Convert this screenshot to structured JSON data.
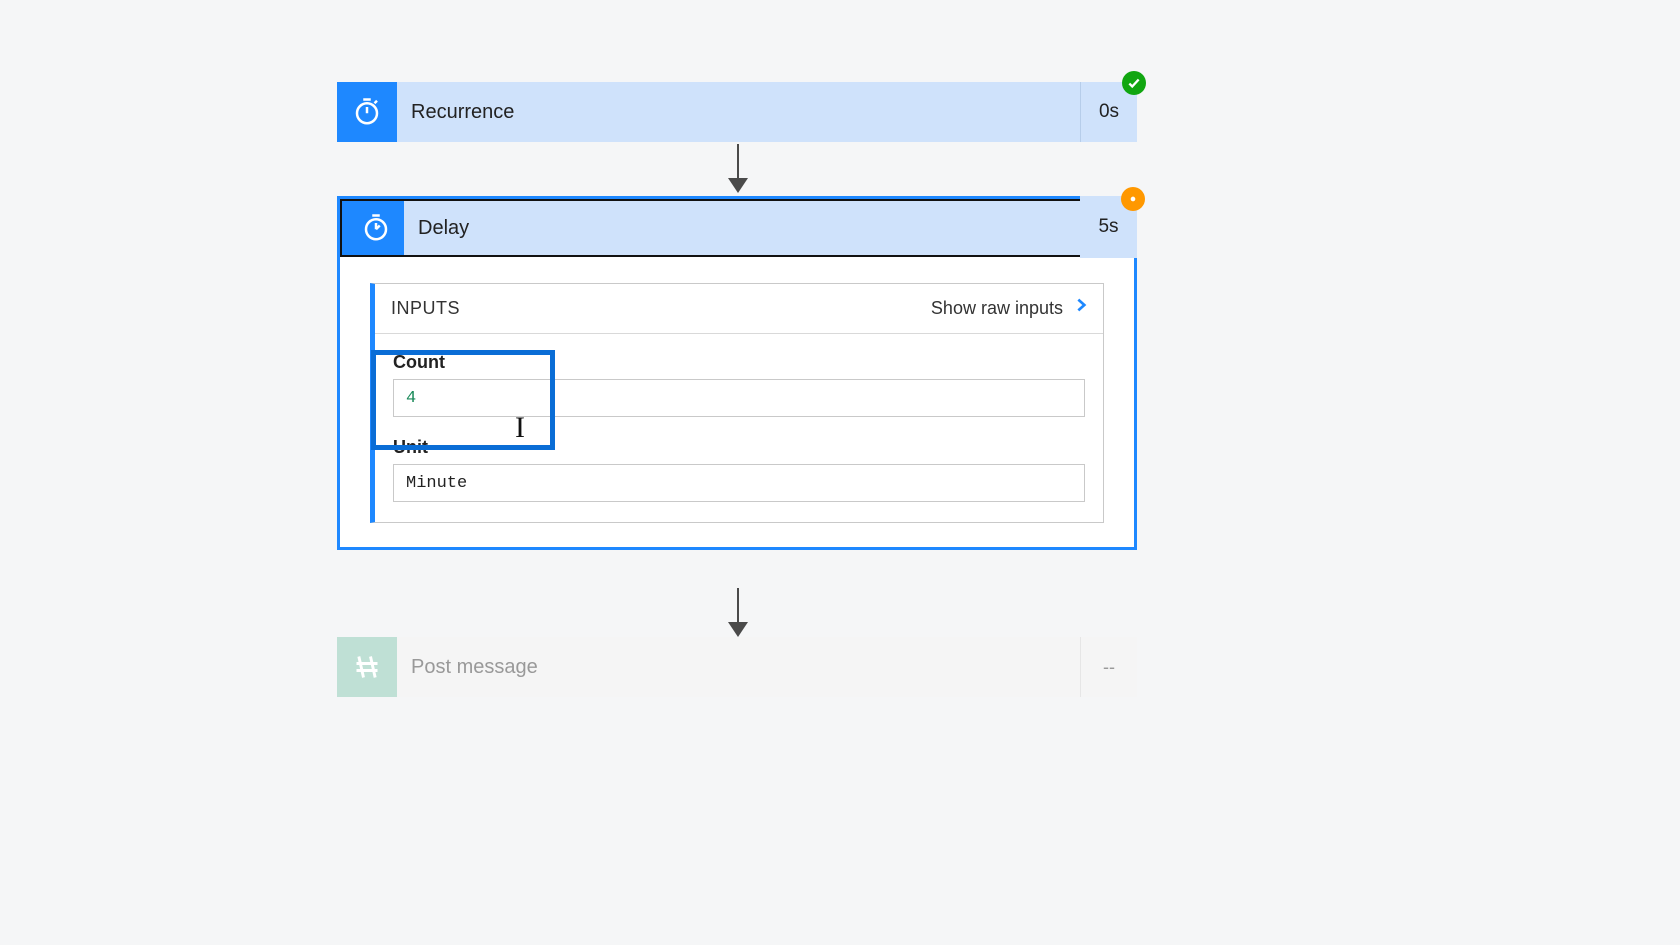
{
  "steps": {
    "recurrence": {
      "title": "Recurrence",
      "duration": "0s",
      "status": "success"
    },
    "delay": {
      "title": "Delay",
      "duration": "5s",
      "status": "warning",
      "inputs_header": "INPUTS",
      "show_raw_label": "Show raw inputs",
      "fields": {
        "count_label": "Count",
        "count_value": "4",
        "unit_label": "Unit",
        "unit_value": "Minute"
      }
    },
    "post_message": {
      "title": "Post message",
      "duration": "--"
    }
  },
  "colors": {
    "brand_blue": "#1e88ff",
    "header_bg": "#cfe2fb",
    "success": "#11a611",
    "warning": "#ff9800"
  }
}
